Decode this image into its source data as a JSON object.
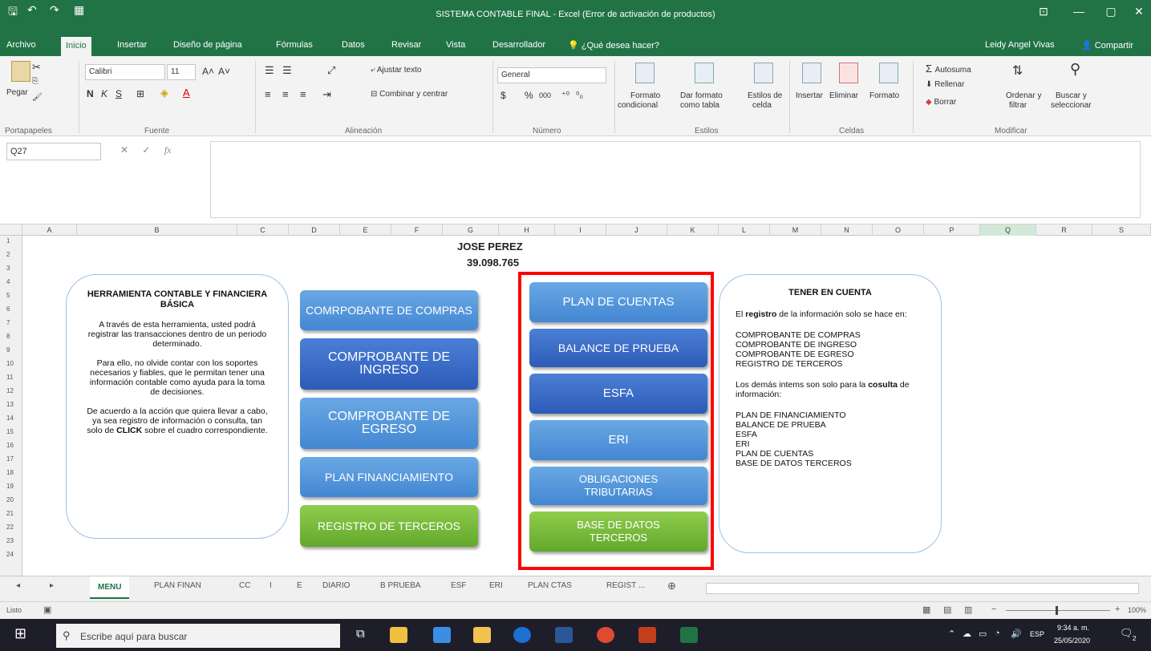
{
  "window": {
    "title": "SISTEMA CONTABLE FINAL - Excel (Error de activación de productos)",
    "user": "Leidy Angel Vivas",
    "share": "Compartir",
    "minimize_glyph": "—",
    "restore_glyph": "▢",
    "close_glyph": "✕",
    "ribbon_toggle_glyph": "⊡"
  },
  "ribbon_tabs": [
    "Archivo",
    "Inicio",
    "Insertar",
    "Diseño de página",
    "Fórmulas",
    "Datos",
    "Revisar",
    "Vista",
    "Desarrollador",
    "¿Qué desea hacer?"
  ],
  "ribbon": {
    "paste": "Pegar",
    "font_name": "Calibri",
    "font_size": "11",
    "bold": "N",
    "italic": "K",
    "underline": "S",
    "wrap_text": "Ajustar texto",
    "merge_center": "Combinar y centrar",
    "number_format": "General",
    "currency": "$",
    "percent": "%",
    "thousands": "000",
    "cond_format": [
      "Formato",
      "condicional"
    ],
    "format_table": [
      "Dar formato",
      "como tabla"
    ],
    "cell_styles": [
      "Estilos de",
      "celda"
    ],
    "insert": "Insertar",
    "delete": "Eliminar",
    "format": "Formato",
    "autosum": "Autosuma",
    "fill": "Rellenar",
    "clear": "Borrar",
    "sort": [
      "Ordenar y",
      "filtrar"
    ],
    "find": [
      "Buscar y",
      "seleccionar"
    ],
    "groups": [
      "Portapapeles",
      "Fuente",
      "Alineación",
      "Número",
      "Estilos",
      "Celdas",
      "Modificar"
    ]
  },
  "formula_bar": {
    "cell_ref": "Q27",
    "fx": "fx",
    "value": ""
  },
  "columns": [
    "A",
    "B",
    "C",
    "D",
    "E",
    "F",
    "G",
    "H",
    "I",
    "J",
    "K",
    "L",
    "M",
    "N",
    "O",
    "P",
    "Q",
    "R",
    "S"
  ],
  "rows": [
    "1",
    "2",
    "3",
    "4",
    "5",
    "6",
    "7",
    "8",
    "9",
    "10",
    "11",
    "12",
    "13",
    "14",
    "15",
    "16",
    "17",
    "18",
    "19",
    "20",
    "21",
    "22",
    "23",
    "24"
  ],
  "sheet": {
    "owner_name": "JOSE PEREZ",
    "owner_id": "39.098.765",
    "left_card": {
      "title": "HERRAMIENTA CONTABLE Y FINANCIERA BÁSICA",
      "p1": "A través de esta herramienta, usted podrá registrar las transacciones dentro de un periodo determinado.",
      "p2": "Para ello, no olvide contar con los soportes necesarios y fiables, que le permitan tener una información contable como ayuda para la toma de decisiones.",
      "p3_a": "De acuerdo a la acción que quiera llevar a cabo, ya sea registro de información o consulta, tan solo de",
      "p3_click": "CLICK",
      "p3_b": "sobre el cuadro correspondiente."
    },
    "buttons_left": [
      {
        "label": "COMRPOBANTE DE COMPRAS"
      },
      {
        "label": "COMPROBANTE DE INGRESO"
      },
      {
        "label": "COMPROBANTE DE EGRESO"
      },
      {
        "label": "PLAN FINANCIAMIENTO"
      },
      {
        "label": "REGISTRO DE TERCEROS"
      }
    ],
    "buttons_right": [
      {
        "label": "PLAN DE CUENTAS"
      },
      {
        "label": "BALANCE DE PRUEBA"
      },
      {
        "label": "ESFA"
      },
      {
        "label": "ERI"
      },
      {
        "label": "OBLIGACIONES TRIBUTARIAS"
      },
      {
        "label": "BASE DE DATOS TERCEROS"
      }
    ],
    "right_card": {
      "title": "TENER EN CUENTA",
      "intro_a": "El",
      "intro_b": "registro",
      "intro_c": "de la información solo se hace en:",
      "list1": [
        "COMPROBANTE DE COMPRAS",
        "COMPROBANTE DE INGRESO",
        "COMPROBANTE DE EGRESO",
        "REGISTRO DE TERCEROS"
      ],
      "intro2_a": "Los demás intems son solo para la",
      "intro2_b": "cosulta",
      "intro2_c": "de información:",
      "list2": [
        "PLAN DE FINANCIAMIENTO",
        "BALANCE DE PRUEBA",
        "ESFA",
        "ERI",
        "PLAN DE CUENTAS",
        "BASE DE DATOS TERCEROS"
      ]
    }
  },
  "sheet_tabs": [
    "MENU",
    "PLAN FINAN",
    "CC",
    "I",
    "E",
    "DIARIO",
    "B PRUEBA",
    "ESF",
    "ERI",
    "PLAN CTAS",
    "REGIST ..."
  ],
  "status": {
    "mode": "Listo",
    "zoom": "100%"
  },
  "taskbar": {
    "search_placeholder": "Escribe aquí para buscar",
    "lang": "ESP",
    "time": "9:34 a. m.",
    "date": "25/05/2020",
    "notif_count": "2"
  },
  "colors": {
    "excel_green": "#217346",
    "button_blue": "#4387d2",
    "button_dark": "#2c5bb8",
    "button_green": "#63a82c",
    "highlight": "#ff0000"
  }
}
